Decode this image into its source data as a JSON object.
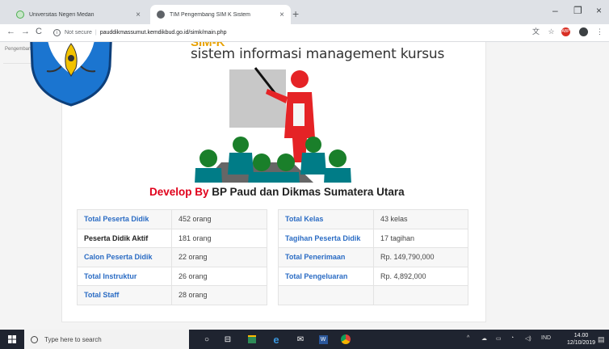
{
  "browser": {
    "tabs": [
      {
        "title": "Universitas Negeri Medan",
        "active": false
      },
      {
        "title": "TIM Pengembang SIM K Sistem",
        "active": true
      }
    ],
    "security_label": "Not secure",
    "url": "pauddikmassumut.kemdikbud.go.id/simk/main.php",
    "toolbar_icons": [
      "translate-icon",
      "bookmark-star-icon",
      "extension-icon",
      "profile-icon",
      "menu-icon"
    ]
  },
  "sidebar": {
    "label": "Pengembang"
  },
  "page": {
    "brand_tagline": "sistem informasi management kursus",
    "develop_prefix": "Develop By",
    "develop_org": "BP Paud dan Dikmas Sumatera Utara",
    "stats_left": [
      {
        "label": "Total Peserta Didik",
        "value": "452 orang"
      },
      {
        "label": "Peserta Didik Aktif",
        "value": "181 orang"
      },
      {
        "label": "Calon Peserta Didik",
        "value": "22 orang"
      },
      {
        "label": "Total Instruktur",
        "value": "26 orang"
      },
      {
        "label": "Total Staff",
        "value": "28 orang"
      }
    ],
    "stats_right": [
      {
        "label": "Total Kelas",
        "value": "43 kelas"
      },
      {
        "label": "Tagihan Peserta Didik",
        "value": "17 tagihan"
      },
      {
        "label": "Total Penerimaan",
        "value": "Rp. 149,790,000"
      },
      {
        "label": "Total Pengeluaran",
        "value": "Rp. 4,892,000"
      },
      {
        "label": "",
        "value": ""
      }
    ]
  },
  "taskbar": {
    "search_placeholder": "Type here to search",
    "language": "IND",
    "time": "14.00",
    "date": "12/10/2019"
  },
  "colors": {
    "accent_blue": "#2b6cc4",
    "develop_red": "#e0001b",
    "chrome_tabstrip": "#dee1e6",
    "taskbar": "#1f2430"
  }
}
